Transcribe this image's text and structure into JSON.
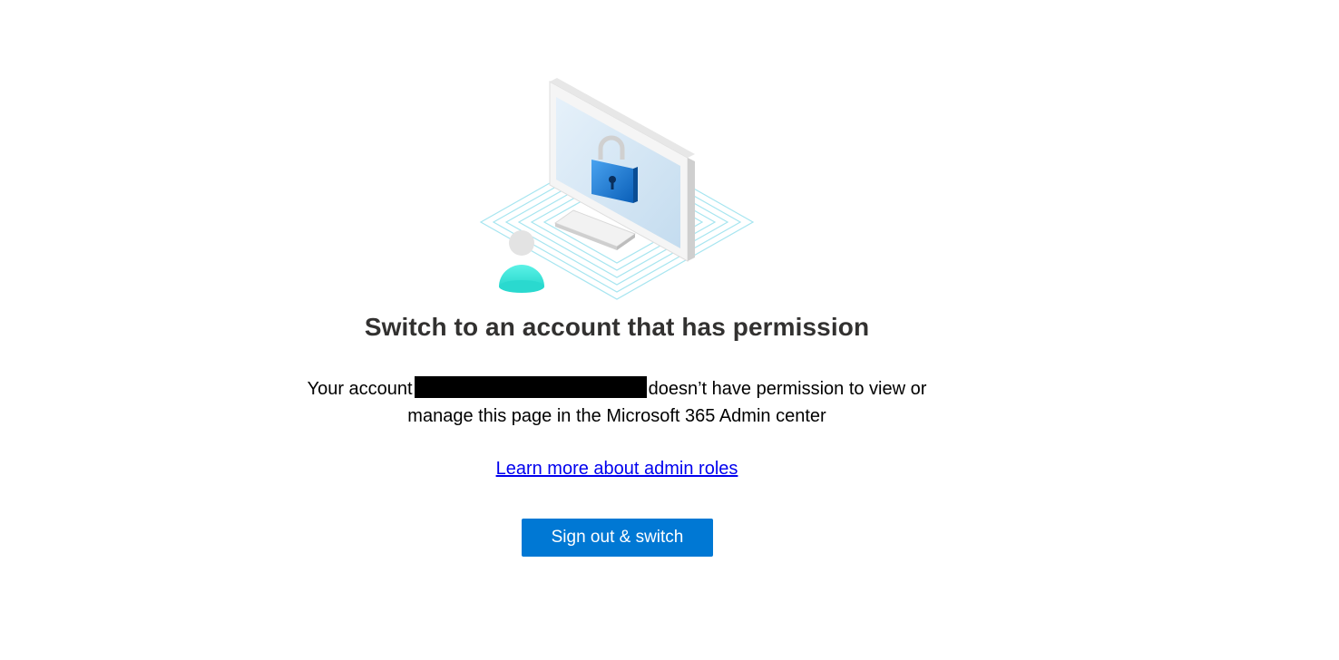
{
  "heading": "Switch to an account that has permission",
  "message": {
    "prefix": "Your account",
    "suffix_line1": "doesn’t have permission to view or",
    "line2": "manage this page in the Microsoft 365 Admin center"
  },
  "learn_more_link": "Learn more about admin roles",
  "primary_button": "Sign out & switch",
  "icons": {
    "illustration": "locked-computer-illustration",
    "lock": "lock-icon",
    "person": "person-icon"
  },
  "colors": {
    "button_bg": "#0078d4",
    "link": "#0000ee",
    "heading": "#323130",
    "person_accent": "#3ee8dc"
  }
}
